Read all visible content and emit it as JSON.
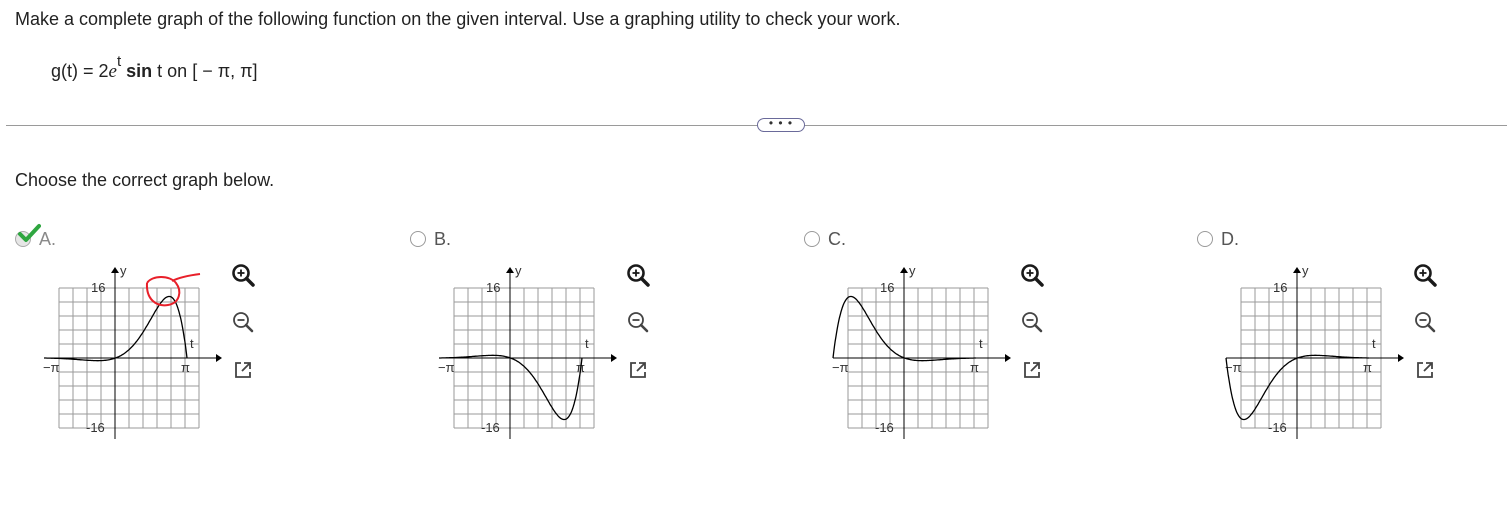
{
  "question": {
    "text": "Make a complete graph of the following function on the given interval. Use a graphing utility to check your work.",
    "formula": {
      "lhs": "g(t) = 2",
      "base": "e",
      "exponent": "t",
      "func": "sin",
      "rest": " t on [ − π, π]"
    }
  },
  "more_button_label": "• • •",
  "prompt": "Choose the correct graph below.",
  "options": [
    {
      "label": "A.",
      "selected": true,
      "correct": true,
      "curve": "positive-peak",
      "annotated": true
    },
    {
      "label": "B.",
      "selected": false,
      "correct": false,
      "curve": "negative-trough",
      "annotated": false
    },
    {
      "label": "C.",
      "selected": false,
      "correct": false,
      "curve": "left-peak",
      "annotated": false
    },
    {
      "label": "D.",
      "selected": false,
      "correct": false,
      "curve": "left-trough",
      "annotated": false
    }
  ],
  "axis_labels": {
    "x": "t",
    "y": "y",
    "y_top": "16",
    "y_bottom": "-16",
    "x_left": "−π",
    "x_right": "π"
  },
  "tools": [
    "zoom-in-icon",
    "zoom-out-icon",
    "open-new-window-icon"
  ],
  "colors": {
    "checkmark": "#2fa640",
    "annotation": "#e8202a",
    "grid": "#9a9a9a",
    "curve": "#000000"
  }
}
